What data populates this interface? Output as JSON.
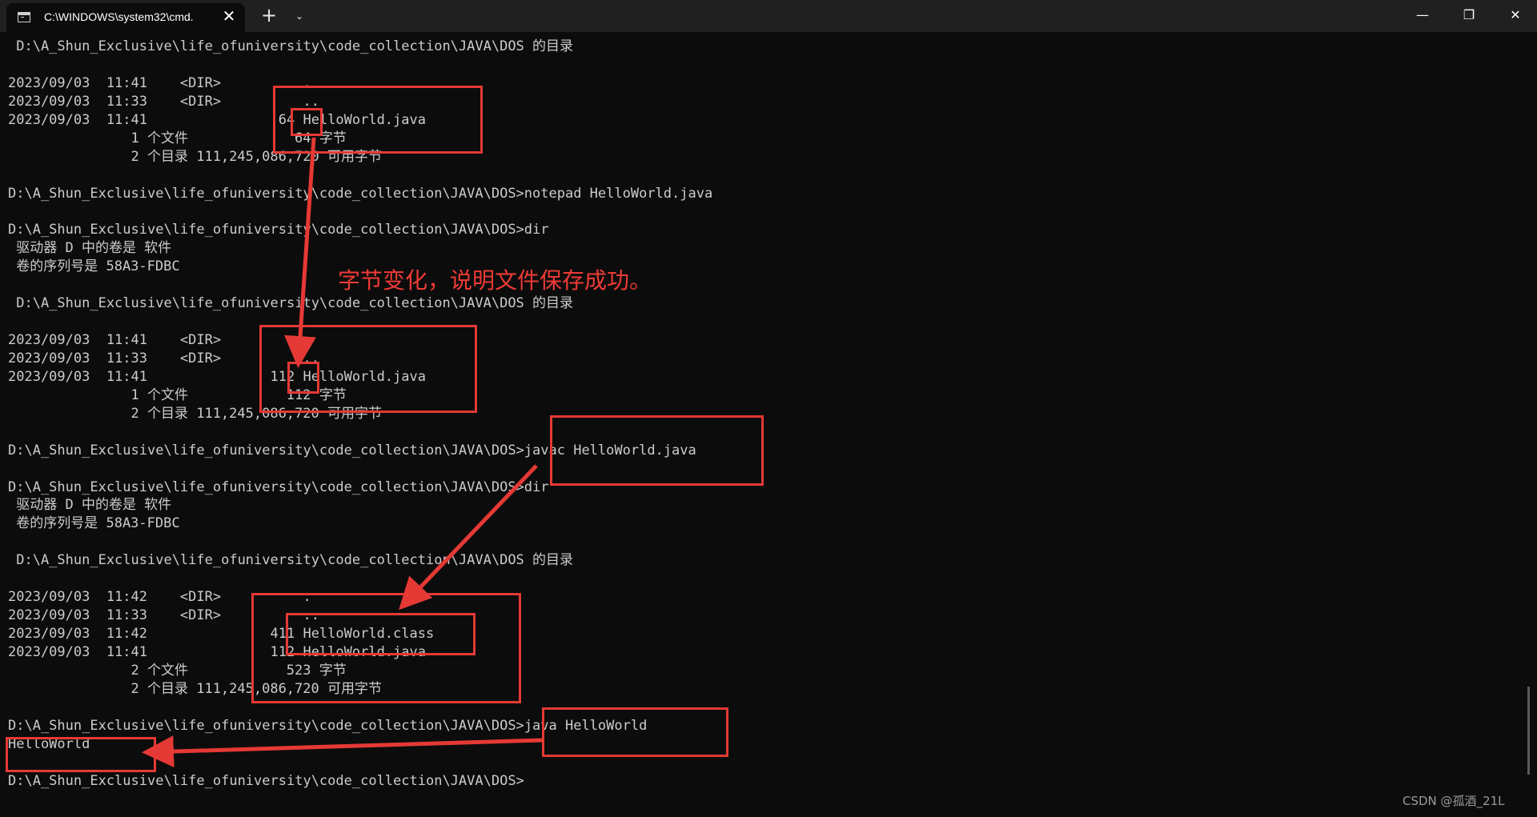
{
  "window": {
    "tab_title": "C:\\WINDOWS\\system32\\cmd.",
    "tab_close": "✕",
    "new_tab": "+",
    "dropdown": "⌄",
    "minimize": "—",
    "maximize": "❐",
    "close": "✕"
  },
  "terminal": {
    "lines": [
      " D:\\A_Shun_Exclusive\\life_ofuniversity\\code_collection\\JAVA\\DOS 的目录",
      "",
      "2023/09/03  11:41    <DIR>          .",
      "2023/09/03  11:33    <DIR>          ..",
      "2023/09/03  11:41                64 HelloWorld.java",
      "               1 个文件             64 字节",
      "               2 个目录 111,245,086,720 可用字节",
      "",
      "D:\\A_Shun_Exclusive\\life_ofuniversity\\code_collection\\JAVA\\DOS>notepad HelloWorld.java",
      "",
      "D:\\A_Shun_Exclusive\\life_ofuniversity\\code_collection\\JAVA\\DOS>dir",
      " 驱动器 D 中的卷是 软件",
      " 卷的序列号是 58A3-FDBC",
      "",
      " D:\\A_Shun_Exclusive\\life_ofuniversity\\code_collection\\JAVA\\DOS 的目录",
      "",
      "2023/09/03  11:41    <DIR>          .",
      "2023/09/03  11:33    <DIR>          ..",
      "2023/09/03  11:41               112 HelloWorld.java",
      "               1 个文件            112 字节",
      "               2 个目录 111,245,086,720 可用字节",
      "",
      "D:\\A_Shun_Exclusive\\life_ofuniversity\\code_collection\\JAVA\\DOS>javac HelloWorld.java",
      "",
      "D:\\A_Shun_Exclusive\\life_ofuniversity\\code_collection\\JAVA\\DOS>dir",
      " 驱动器 D 中的卷是 软件",
      " 卷的序列号是 58A3-FDBC",
      "",
      " D:\\A_Shun_Exclusive\\life_ofuniversity\\code_collection\\JAVA\\DOS 的目录",
      "",
      "2023/09/03  11:42    <DIR>          .",
      "2023/09/03  11:33    <DIR>          ..",
      "2023/09/03  11:42               411 HelloWorld.class",
      "2023/09/03  11:41               112 HelloWorld.java",
      "               2 个文件            523 字节",
      "               2 个目录 111,245,086,720 可用字节",
      "",
      "D:\\A_Shun_Exclusive\\life_ofuniversity\\code_collection\\JAVA\\DOS>java HelloWorld",
      "HelloWorld",
      "",
      "D:\\A_Shun_Exclusive\\life_ofuniversity\\code_collection\\JAVA\\DOS>"
    ]
  },
  "annotation": {
    "text": "字节变化，说明文件保存成功。",
    "color": "#e53935"
  },
  "watermark": "CSDN @孤酒_21L"
}
